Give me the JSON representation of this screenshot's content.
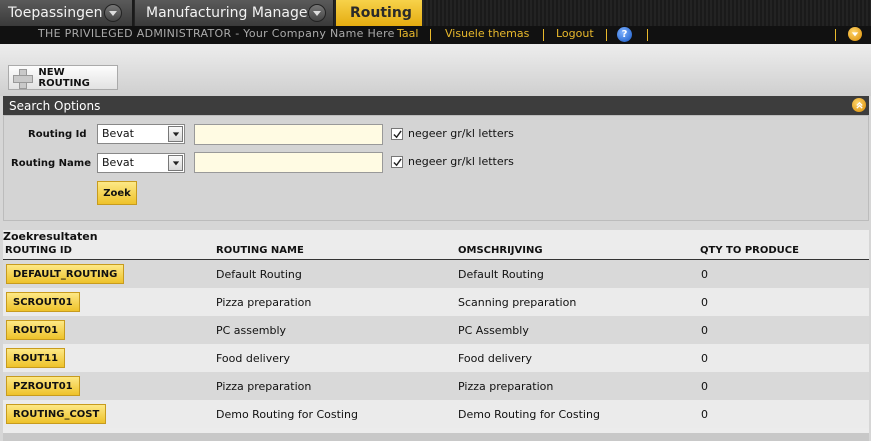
{
  "tabs": [
    {
      "label": "Toepassingen",
      "has_menu": true
    },
    {
      "label": "Manufacturing Manager",
      "has_menu": true
    },
    {
      "label": "Routing",
      "active": true
    }
  ],
  "header": {
    "admin_text": "THE PRIVILEGED ADMINISTRATOR - Your Company Name Here",
    "links": [
      "Taal",
      "Visuele themas",
      "Logout"
    ],
    "help_icon": "help-icon",
    "accent": "#e9b92c"
  },
  "actions": {
    "new_routing_label": "NEW ROUTING"
  },
  "search": {
    "title": "Search Options",
    "fields": [
      {
        "label": "Routing Id",
        "operator": "Bevat",
        "value": "",
        "ignore_case_checked": true,
        "ignore_case_label": "negeer gr/kl letters"
      },
      {
        "label": "Routing Name",
        "operator": "Bevat",
        "value": "",
        "ignore_case_checked": true,
        "ignore_case_label": "negeer gr/kl letters"
      }
    ],
    "submit_label": "Zoek"
  },
  "results": {
    "title": "Zoekresultaten",
    "columns": [
      "ROUTING ID",
      "ROUTING NAME",
      "OMSCHRIJVING",
      "QTY TO PRODUCE"
    ],
    "rows": [
      {
        "id": "DEFAULT_ROUTING",
        "name": "Default Routing",
        "description": "Default Routing",
        "qty": "0"
      },
      {
        "id": "SCROUT01",
        "name": "Pizza preparation",
        "description": "Scanning preparation",
        "qty": "0"
      },
      {
        "id": "ROUT01",
        "name": "PC assembly",
        "description": "PC Assembly",
        "qty": "0"
      },
      {
        "id": "ROUT11",
        "name": "Food delivery",
        "description": "Food delivery",
        "qty": "0"
      },
      {
        "id": "PZROUT01",
        "name": "Pizza preparation",
        "description": "Pizza preparation",
        "qty": "0"
      },
      {
        "id": "ROUTING_COST",
        "name": "Demo Routing for Costing",
        "description": "Demo Routing for Costing",
        "qty": "0"
      }
    ]
  }
}
